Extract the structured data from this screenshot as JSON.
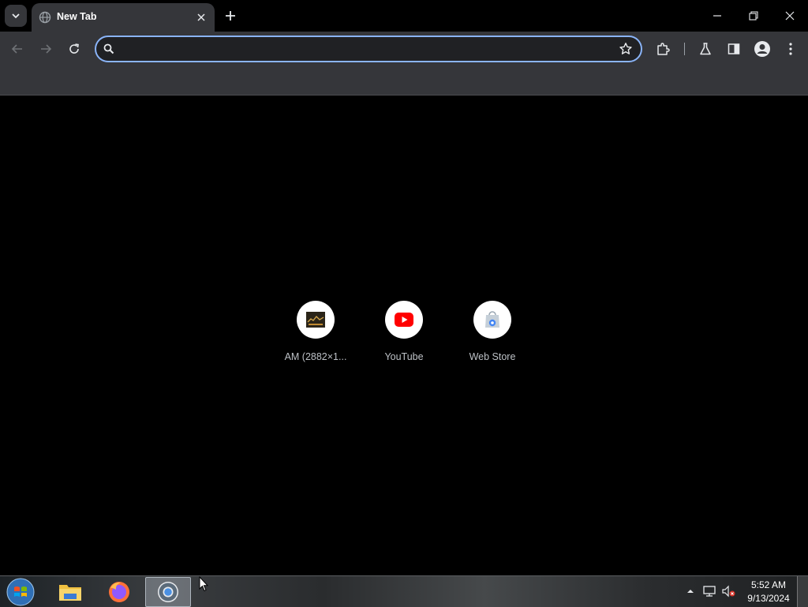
{
  "tabs": [
    {
      "title": "New Tab",
      "active": true
    }
  ],
  "omnibox": {
    "value": "",
    "placeholder": ""
  },
  "shortcuts": [
    {
      "label": "AM (2882×1...",
      "icon": "image-thumbnail-icon"
    },
    {
      "label": "YouTube",
      "icon": "youtube-icon"
    },
    {
      "label": "Web Store",
      "icon": "web-store-icon"
    }
  ],
  "taskbar": {
    "pinned": [
      "file-explorer-icon",
      "firefox-icon",
      "chrome-icon"
    ],
    "active": "chrome-icon"
  },
  "clock": {
    "time": "5:52 AM",
    "date": "9/13/2024"
  },
  "colors": {
    "toolbar": "#35363a",
    "omnibox_border": "#8ab4f8",
    "youtube_red": "#ff0000"
  }
}
